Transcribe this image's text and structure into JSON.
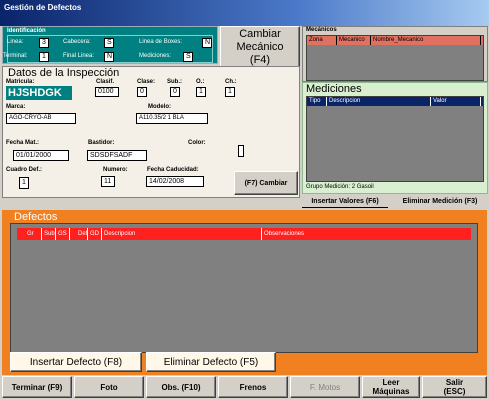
{
  "window": {
    "title": "Gestión de Defectos"
  },
  "identificacion": {
    "title": "Identificación",
    "linea_label": "Linea:",
    "linea_value": "3",
    "cabecera_label": "Cabecera:",
    "cabecera_value": "S",
    "linea_boxes_label": "Linea de Boxes:",
    "linea_boxes_value": "N",
    "terminal_label": "Terminal:",
    "terminal_value": "1",
    "final_linea_label": "Final Linea:",
    "final_linea_value": "N",
    "mediciones_label": "Mediciones:",
    "mediciones_value": "S"
  },
  "cambiar_mecanico": {
    "label_line1": "Cambiar",
    "label_line2": "Mecánico",
    "label_line3": "(F4)"
  },
  "mecanicos": {
    "title": "Mecánicos",
    "columns": [
      "Zona",
      "Mecanico",
      "Nombre_Mecanico"
    ]
  },
  "inspeccion": {
    "title": "Datos de la Inspección",
    "matricula_label": "Matricula:",
    "matricula_value": "HJSHDGK",
    "clasif_label": "Clasif.",
    "clasif_value": "0100",
    "clase_label": "Clase:",
    "clase_value": "0",
    "sub_label": "Sub.:",
    "sub_value": "0",
    "o_label": "O.:",
    "o_value": "1",
    "ch_label": "Ch.:",
    "ch_value": "1",
    "marca_label": "Marca:",
    "marca_value": "AGO-CRYO-AB",
    "modelo_label": "Modelo:",
    "modelo_value": "A110.35/2 1 BLA",
    "fecha_mat_label": "Fecha Mat.:",
    "fecha_mat_value": "01/01/2000",
    "bastidor_label": "Bastidor:",
    "bastidor_value": "SDSDFSADF",
    "color_label": "Color:",
    "cuadro_def_label": "Cuadro Def.:",
    "cuadro_def_value": "1",
    "numero_label": "Numero:",
    "numero_value": "11",
    "fecha_caducidad_label": "Fecha Caducidad:",
    "fecha_caducidad_value": "14/02/2008",
    "cambiar_button": "(F7) Cambiar"
  },
  "mediciones": {
    "title": "Mediciones",
    "columns": [
      "Tipo",
      "Descripcion",
      "Valor"
    ],
    "grupo_medicion": "Grupo Medición: 2 Gasoil",
    "insertar_button": "Insertar Valores (F6)",
    "eliminar_button": "Eliminar Medición (F3)"
  },
  "defectos": {
    "title": "Defectos",
    "columns": [
      "Gr",
      "Sub",
      "GS",
      "Def",
      "GD",
      "Descripcion",
      "Observaciones"
    ],
    "insertar_button": "Insertar Defecto (F8)",
    "eliminar_button": "Eliminar Defecto (F5)"
  },
  "toolbar": {
    "terminar": "Terminar (F9)",
    "foto": "Foto",
    "obs": "Obs. (F10)",
    "frenos": "Frenos",
    "f_motos": "F. Motos",
    "leer_line1": "Leer",
    "leer_line2": "Máquinas",
    "salir_line1": "Salir",
    "salir_line2": "(ESC)"
  },
  "colors": {
    "accent_orange": "#f08020",
    "teal": "#008080",
    "green_panel": "#d8f0d0",
    "defect_header_red": "#ff2020"
  }
}
